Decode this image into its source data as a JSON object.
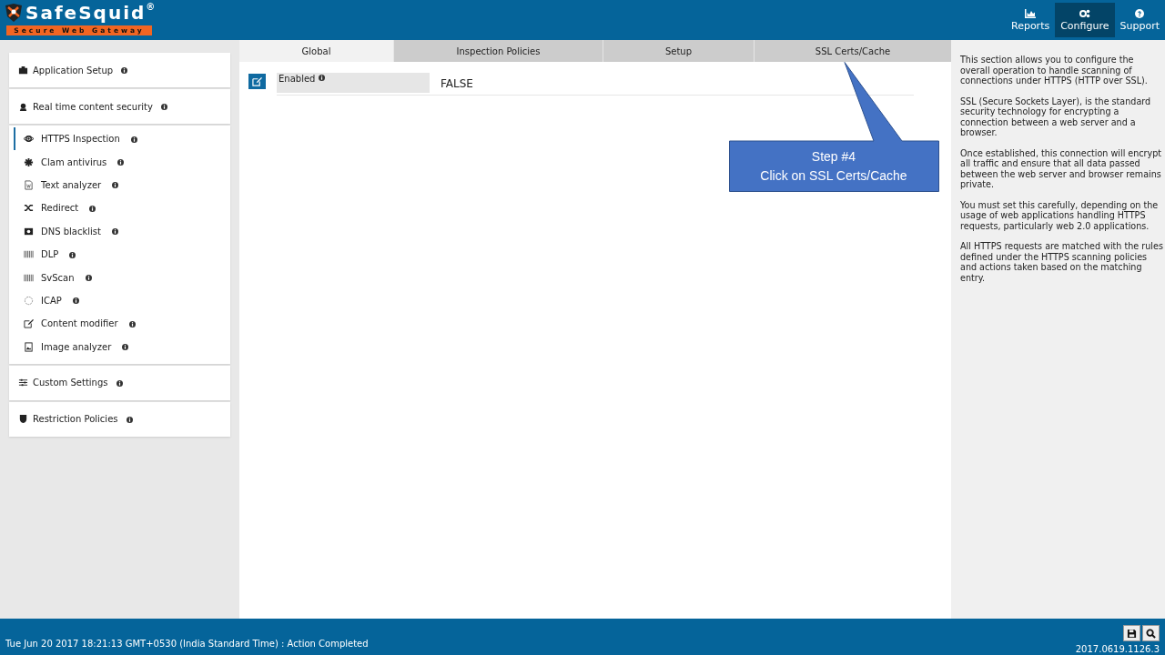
{
  "header": {
    "logo": {
      "name": "SafeSquid",
      "mark": "®",
      "tagline": "Secure Web Gateway"
    },
    "nav": [
      {
        "label": "Reports",
        "selected": false
      },
      {
        "label": "Configure",
        "selected": true
      },
      {
        "label": "Support",
        "selected": false
      }
    ]
  },
  "sidebar": {
    "sections": [
      {
        "label": "Application Setup"
      },
      {
        "label": "Real time content security",
        "children": [
          {
            "label": "HTTPS Inspection",
            "selected": true
          },
          {
            "label": "Clam antivirus",
            "selected": false
          },
          {
            "label": "Text analyzer",
            "selected": false
          },
          {
            "label": "Redirect",
            "selected": false
          },
          {
            "label": "DNS blacklist",
            "selected": false
          },
          {
            "label": "DLP",
            "selected": false
          },
          {
            "label": "SvScan",
            "selected": false
          },
          {
            "label": "ICAP",
            "selected": false
          },
          {
            "label": "Content modifier",
            "selected": false
          },
          {
            "label": "Image analyzer",
            "selected": false
          }
        ]
      },
      {
        "label": "Custom Settings"
      },
      {
        "label": "Restriction Policies"
      }
    ]
  },
  "tabs": [
    {
      "label": "Global",
      "selected": true
    },
    {
      "label": "Inspection Policies",
      "selected": false
    },
    {
      "label": "Setup",
      "selected": false
    },
    {
      "label": "SSL Certs/Cache",
      "selected": false
    }
  ],
  "form": {
    "fields": [
      {
        "label": "Enabled",
        "value": "FALSE"
      }
    ]
  },
  "callout": {
    "lines": [
      "Step #4",
      "Click on SSL Certs/Cache"
    ]
  },
  "help": {
    "paragraphs": [
      "This section allows you to configure the overall operation to handle scanning of connections under HTTPS (HTTP over SSL).",
      "SSL (Secure Sockets Layer), is the standard security technology for encrypting a connection between a web server and a browser.",
      "Once established, this connection will encrypt all traffic and ensure that all data passed between the web server and browser remains private.",
      "You must set this carefully, depending on the usage of web applications handling HTTPS requests, particularly web 2.0 applications.",
      "All HTTPS requests are matched with the rules defined under the HTTPS scanning policies and actions taken based on the matching entry."
    ]
  },
  "status_bar": {
    "message": "Tue Jun 20 2017 18:21:13 GMT+0530 (India Standard Time) : Action Completed",
    "version": "2017.0619.1126.3"
  }
}
